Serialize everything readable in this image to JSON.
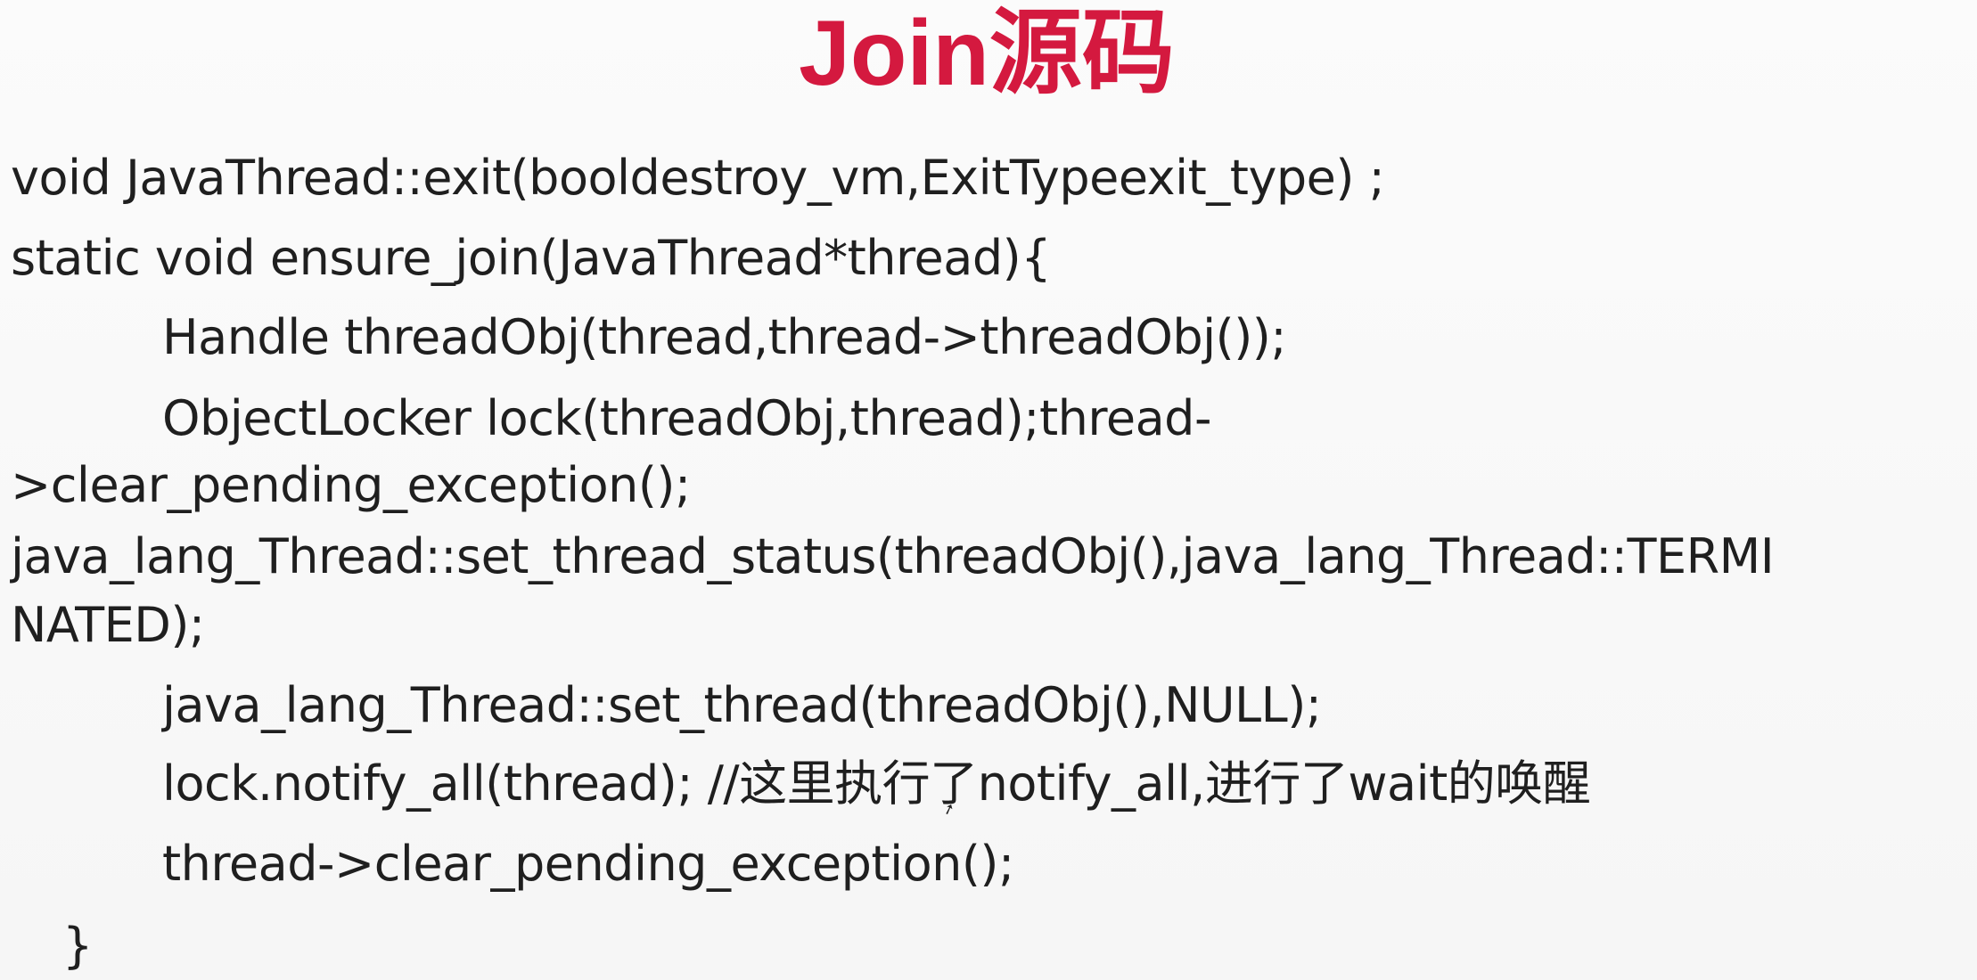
{
  "slide": {
    "title": "Join源码",
    "lines": [
      "void JavaThread::exit(booldestroy_vm,ExitTypeexit_type) ;",
      "static void ensure_join(JavaThread*thread){",
      "Handle threadObj(thread,thread->threadObj());",
      "ObjectLocker lock(threadObj,thread);thread-",
      ">clear_pending_exception();",
      "java_lang_Thread::set_thread_status(threadObj(),java_lang_Thread::TERMI",
      "NATED);",
      "java_lang_Thread::set_thread(threadObj(),NULL);",
      "lock.notify_all(thread);  //这里执行了notify_all,进行了wait的唤醒",
      "thread->clear_pending_exception();",
      "}"
    ]
  }
}
